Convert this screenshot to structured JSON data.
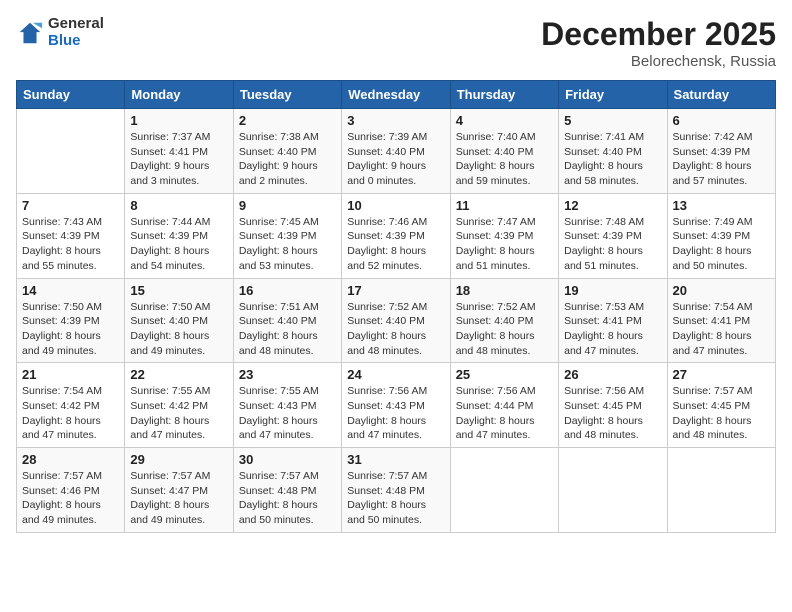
{
  "logo": {
    "general": "General",
    "blue": "Blue"
  },
  "title": "December 2025",
  "subtitle": "Belorechensk, Russia",
  "days_header": [
    "Sunday",
    "Monday",
    "Tuesday",
    "Wednesday",
    "Thursday",
    "Friday",
    "Saturday"
  ],
  "weeks": [
    [
      {
        "day": "",
        "info": ""
      },
      {
        "day": "1",
        "info": "Sunrise: 7:37 AM\nSunset: 4:41 PM\nDaylight: 9 hours\nand 3 minutes."
      },
      {
        "day": "2",
        "info": "Sunrise: 7:38 AM\nSunset: 4:40 PM\nDaylight: 9 hours\nand 2 minutes."
      },
      {
        "day": "3",
        "info": "Sunrise: 7:39 AM\nSunset: 4:40 PM\nDaylight: 9 hours\nand 0 minutes."
      },
      {
        "day": "4",
        "info": "Sunrise: 7:40 AM\nSunset: 4:40 PM\nDaylight: 8 hours\nand 59 minutes."
      },
      {
        "day": "5",
        "info": "Sunrise: 7:41 AM\nSunset: 4:40 PM\nDaylight: 8 hours\nand 58 minutes."
      },
      {
        "day": "6",
        "info": "Sunrise: 7:42 AM\nSunset: 4:39 PM\nDaylight: 8 hours\nand 57 minutes."
      }
    ],
    [
      {
        "day": "7",
        "info": "Sunrise: 7:43 AM\nSunset: 4:39 PM\nDaylight: 8 hours\nand 55 minutes."
      },
      {
        "day": "8",
        "info": "Sunrise: 7:44 AM\nSunset: 4:39 PM\nDaylight: 8 hours\nand 54 minutes."
      },
      {
        "day": "9",
        "info": "Sunrise: 7:45 AM\nSunset: 4:39 PM\nDaylight: 8 hours\nand 53 minutes."
      },
      {
        "day": "10",
        "info": "Sunrise: 7:46 AM\nSunset: 4:39 PM\nDaylight: 8 hours\nand 52 minutes."
      },
      {
        "day": "11",
        "info": "Sunrise: 7:47 AM\nSunset: 4:39 PM\nDaylight: 8 hours\nand 51 minutes."
      },
      {
        "day": "12",
        "info": "Sunrise: 7:48 AM\nSunset: 4:39 PM\nDaylight: 8 hours\nand 51 minutes."
      },
      {
        "day": "13",
        "info": "Sunrise: 7:49 AM\nSunset: 4:39 PM\nDaylight: 8 hours\nand 50 minutes."
      }
    ],
    [
      {
        "day": "14",
        "info": "Sunrise: 7:50 AM\nSunset: 4:39 PM\nDaylight: 8 hours\nand 49 minutes."
      },
      {
        "day": "15",
        "info": "Sunrise: 7:50 AM\nSunset: 4:40 PM\nDaylight: 8 hours\nand 49 minutes."
      },
      {
        "day": "16",
        "info": "Sunrise: 7:51 AM\nSunset: 4:40 PM\nDaylight: 8 hours\nand 48 minutes."
      },
      {
        "day": "17",
        "info": "Sunrise: 7:52 AM\nSunset: 4:40 PM\nDaylight: 8 hours\nand 48 minutes."
      },
      {
        "day": "18",
        "info": "Sunrise: 7:52 AM\nSunset: 4:40 PM\nDaylight: 8 hours\nand 48 minutes."
      },
      {
        "day": "19",
        "info": "Sunrise: 7:53 AM\nSunset: 4:41 PM\nDaylight: 8 hours\nand 47 minutes."
      },
      {
        "day": "20",
        "info": "Sunrise: 7:54 AM\nSunset: 4:41 PM\nDaylight: 8 hours\nand 47 minutes."
      }
    ],
    [
      {
        "day": "21",
        "info": "Sunrise: 7:54 AM\nSunset: 4:42 PM\nDaylight: 8 hours\nand 47 minutes."
      },
      {
        "day": "22",
        "info": "Sunrise: 7:55 AM\nSunset: 4:42 PM\nDaylight: 8 hours\nand 47 minutes."
      },
      {
        "day": "23",
        "info": "Sunrise: 7:55 AM\nSunset: 4:43 PM\nDaylight: 8 hours\nand 47 minutes."
      },
      {
        "day": "24",
        "info": "Sunrise: 7:56 AM\nSunset: 4:43 PM\nDaylight: 8 hours\nand 47 minutes."
      },
      {
        "day": "25",
        "info": "Sunrise: 7:56 AM\nSunset: 4:44 PM\nDaylight: 8 hours\nand 47 minutes."
      },
      {
        "day": "26",
        "info": "Sunrise: 7:56 AM\nSunset: 4:45 PM\nDaylight: 8 hours\nand 48 minutes."
      },
      {
        "day": "27",
        "info": "Sunrise: 7:57 AM\nSunset: 4:45 PM\nDaylight: 8 hours\nand 48 minutes."
      }
    ],
    [
      {
        "day": "28",
        "info": "Sunrise: 7:57 AM\nSunset: 4:46 PM\nDaylight: 8 hours\nand 49 minutes."
      },
      {
        "day": "29",
        "info": "Sunrise: 7:57 AM\nSunset: 4:47 PM\nDaylight: 8 hours\nand 49 minutes."
      },
      {
        "day": "30",
        "info": "Sunrise: 7:57 AM\nSunset: 4:48 PM\nDaylight: 8 hours\nand 50 minutes."
      },
      {
        "day": "31",
        "info": "Sunrise: 7:57 AM\nSunset: 4:48 PM\nDaylight: 8 hours\nand 50 minutes."
      },
      {
        "day": "",
        "info": ""
      },
      {
        "day": "",
        "info": ""
      },
      {
        "day": "",
        "info": ""
      }
    ]
  ]
}
